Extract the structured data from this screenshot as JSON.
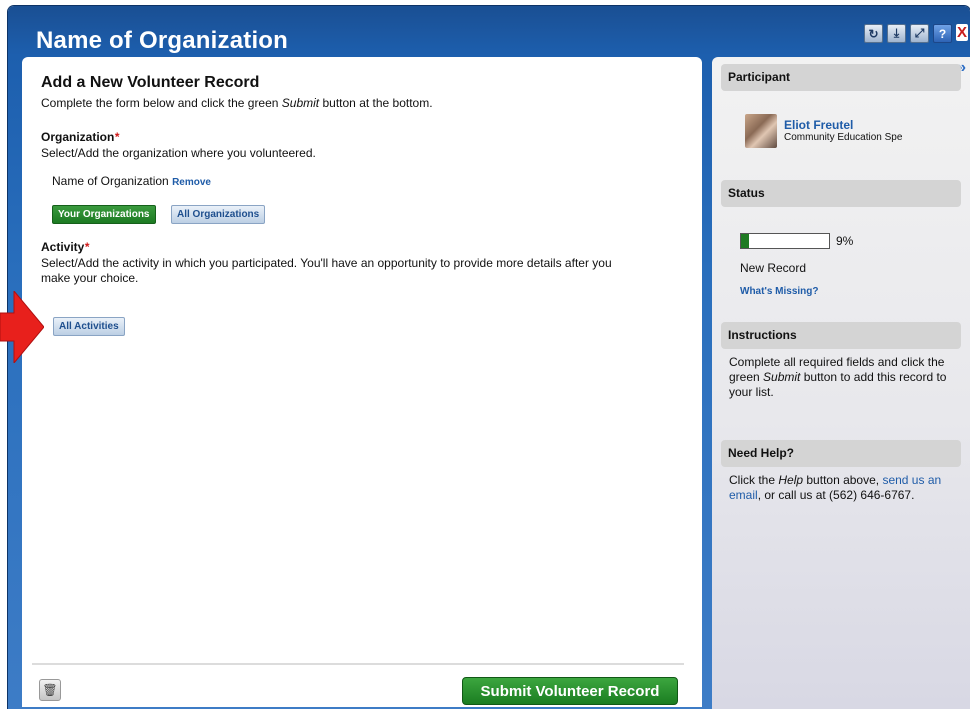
{
  "window": {
    "title": "Name of Organization",
    "controls": {
      "refresh_icon": "refresh-icon",
      "download_icon": "download-icon",
      "expand_icon": "expand-icon",
      "help_label": "?",
      "close_label": "X"
    }
  },
  "form": {
    "heading": "Add a New Volunteer Record",
    "intro_before": "Complete the form below and click the green ",
    "intro_em": "Submit",
    "intro_after": " button at the bottom.",
    "organization": {
      "label": "Organization",
      "required_mark": "*",
      "description": "Select/Add the organization where you volunteered.",
      "selected_value": "Name of Organization",
      "remove_link": "Remove",
      "buttons": [
        "Your Organizations",
        "All Organizations"
      ]
    },
    "activity": {
      "label": "Activity",
      "required_mark": "*",
      "description": "Select/Add the activity in which you participated. You'll have an opportunity to provide more details after you make your choice.",
      "button": "All Activities"
    },
    "submit_label": "Submit Volunteer Record",
    "trash_icon": "trash-icon"
  },
  "sidebar": {
    "collapse_icon": "»",
    "participant": {
      "heading": "Participant",
      "name": "Eliot Freutel",
      "role": "Community Education Spe"
    },
    "status": {
      "heading": "Status",
      "progress_percent": 9,
      "progress_label": "9%",
      "record_state": "New Record",
      "missing_link": "What's Missing?"
    },
    "instructions": {
      "heading": "Instructions",
      "text_before": "Complete all required fields and click the green ",
      "text_em": "Submit",
      "text_after": " button to add this record to your list."
    },
    "help": {
      "heading": "Need Help?",
      "text_1": "Click the ",
      "text_em": "Help",
      "text_2": " button above, ",
      "link": "send us an email",
      "text_3": ", or call us at (562) 646-6767."
    }
  },
  "annotation": {
    "arrow_color": "#e8201c"
  }
}
